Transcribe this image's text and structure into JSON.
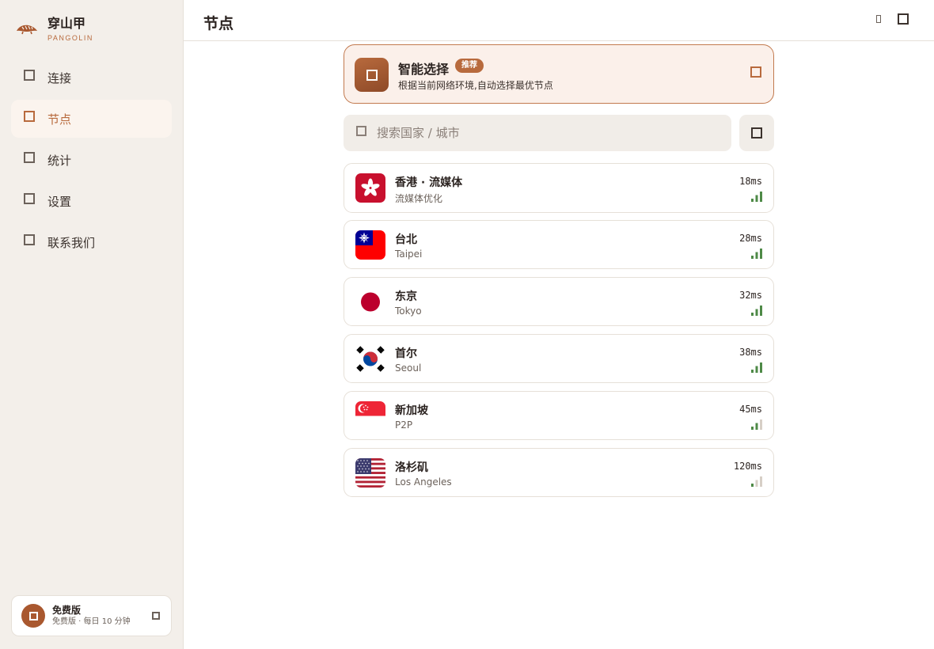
{
  "brand": {
    "name": "穿山甲",
    "sub": "PANGOLIN"
  },
  "sidebar": {
    "items": [
      {
        "label": "连接",
        "active": false
      },
      {
        "label": "节点",
        "active": true
      },
      {
        "label": "统计",
        "active": false
      },
      {
        "label": "设置",
        "active": false
      },
      {
        "label": "联系我们",
        "active": false
      }
    ],
    "plan": {
      "title": "免费版",
      "subtitle": "免费版 · 每日 10 分钟"
    }
  },
  "header": {
    "title": "节点"
  },
  "smart": {
    "title": "智能选择",
    "badge": "推荐",
    "desc": "根据当前网络环境,自动选择最优节点"
  },
  "search": {
    "placeholder": "搜索国家 / 城市"
  },
  "nodes": [
    {
      "name": "香港 · 流媒体",
      "sub": "流媒体优化",
      "latency": "18ms",
      "flag": "hk",
      "signal": 3
    },
    {
      "name": "台北",
      "sub": "Taipei",
      "latency": "28ms",
      "flag": "tw",
      "signal": 3
    },
    {
      "name": "东京",
      "sub": "Tokyo",
      "latency": "32ms",
      "flag": "jp",
      "signal": 3
    },
    {
      "name": "首尔",
      "sub": "Seoul",
      "latency": "38ms",
      "flag": "kr",
      "signal": 3
    },
    {
      "name": "新加坡",
      "sub": "P2P",
      "latency": "45ms",
      "flag": "sg",
      "signal": 2
    },
    {
      "name": "洛杉矶",
      "sub": "Los Angeles",
      "latency": "120ms",
      "flag": "us",
      "signal": 1
    }
  ],
  "colors": {
    "accent": "#b86a3d",
    "signal_on": "#4e8a47",
    "signal_off": "#d7cfc6"
  },
  "icons": {
    "brand": "pangolin-icon",
    "search": "search-icon",
    "filter": "filter-icon",
    "plan_settings": "gear-icon"
  }
}
